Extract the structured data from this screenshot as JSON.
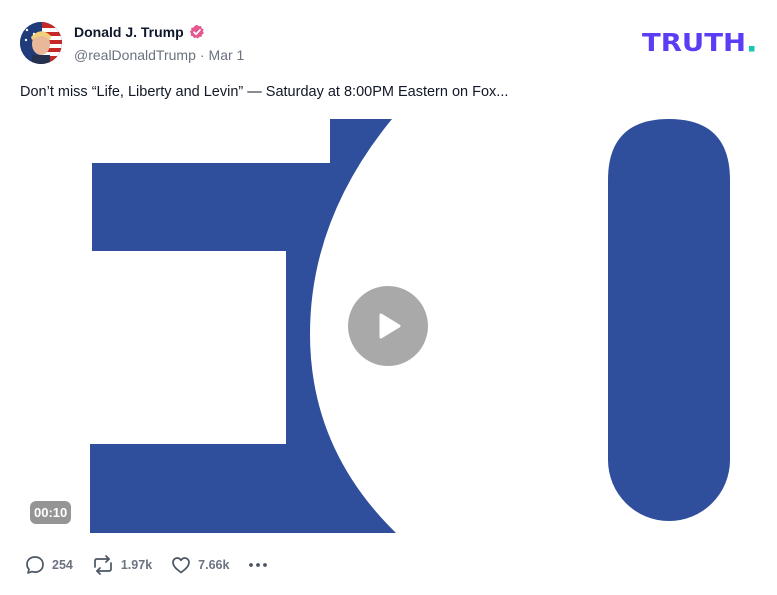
{
  "post": {
    "author_name": "Donald J. Trump",
    "handle": "@realDonaldTrump",
    "separator": "·",
    "date": "Mar 1",
    "text": "Don’t miss “Life, Liberty and Levin” — Saturday at 8:00PM Eastern on Fox...",
    "verified": true
  },
  "brand": {
    "logo_text": "TRUTH",
    "logo_color": "#5b3df5",
    "dot_color": "#17c7b6"
  },
  "video": {
    "duration": "00:10",
    "frame_colors": {
      "shape": "#2f4f9c",
      "background": "#ffffff"
    },
    "play_icon": "play-icon"
  },
  "actions": {
    "replies": "254",
    "retruths": "1.97k",
    "likes": "7.66k"
  },
  "icons": [
    "verified-badge-icon",
    "reply-icon",
    "retruth-icon",
    "like-icon",
    "more-icon",
    "play-icon"
  ]
}
